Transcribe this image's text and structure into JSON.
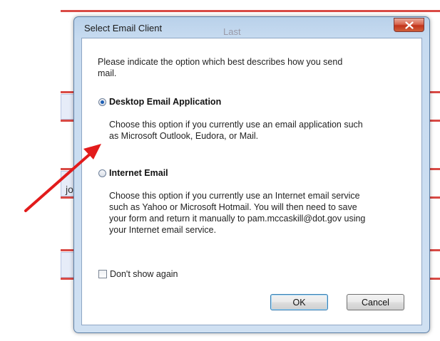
{
  "background": {
    "header_text": "Last",
    "partial_text": "jov"
  },
  "dialog": {
    "title": "Select Email Client",
    "close_glyph": "x",
    "prompt": [
      "Please indicate the option which best describes how you send",
      "mail."
    ],
    "options": [
      {
        "label": "Desktop Email Application",
        "selected": true,
        "description": [
          "Choose this option if you currently use an email application such",
          "as Microsoft Outlook, Eudora, or Mail."
        ]
      },
      {
        "label": "Internet Email",
        "selected": false,
        "description": [
          "Choose this option if you currently use an Internet email service",
          "such as Yahoo or Microsoft Hotmail. You will then need to save",
          "your form and return it manually to pam.mccaskill@dot.gov using",
          "your Internet email service."
        ]
      }
    ],
    "dont_show_again": {
      "label": "Don't show again",
      "checked": false
    },
    "ok_label": "OK",
    "cancel_label": "Cancel"
  },
  "colors": {
    "annotation_arrow": "#e21b1b",
    "background_lines": "#d94a45",
    "selected_radio": "#1d5fb5"
  }
}
